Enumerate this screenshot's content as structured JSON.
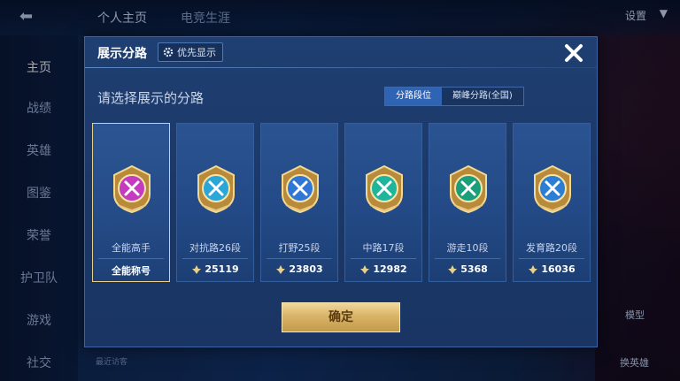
{
  "background": {
    "top_tabs": [
      "个人主页",
      "电竞生涯"
    ],
    "settings_label": "设置",
    "sidebar_items": [
      "主页",
      "战绩",
      "英雄",
      "图鉴",
      "荣誉",
      "护卫队",
      "游戏",
      "社交"
    ],
    "right_labels": [
      "模型",
      "换英雄"
    ]
  },
  "dialog": {
    "title": "展示分路",
    "priority_button": "优先显示",
    "subtitle": "请选择展示的分路",
    "segments": [
      "分路段位",
      "巅峰分路(全国)"
    ],
    "cards": [
      {
        "label": "全能高手",
        "value": "全能称号",
        "icon": "all-round-emblem-icon",
        "color": "#c43bbf",
        "selected": true,
        "has_power_icon": false
      },
      {
        "label": "对抗路26段",
        "value": "25119",
        "icon": "clash-lane-emblem-icon",
        "color": "#2aa6d8",
        "selected": false,
        "has_power_icon": true
      },
      {
        "label": "打野25段",
        "value": "23803",
        "icon": "jungle-emblem-icon",
        "color": "#2f76d6",
        "selected": false,
        "has_power_icon": true
      },
      {
        "label": "中路17段",
        "value": "12982",
        "icon": "mid-lane-emblem-icon",
        "color": "#1fb59a",
        "selected": false,
        "has_power_icon": true
      },
      {
        "label": "游走10段",
        "value": "5368",
        "icon": "roam-emblem-icon",
        "color": "#1b9e7a",
        "selected": false,
        "has_power_icon": true
      },
      {
        "label": "发育路20段",
        "value": "16036",
        "icon": "farm-lane-emblem-icon",
        "color": "#2b7ed4",
        "selected": false,
        "has_power_icon": true
      }
    ],
    "confirm_label": "确定"
  },
  "colors": {
    "accent_gold": "#e9cf8d",
    "segment_active": "#2f63b4"
  },
  "bottom_hint": "最近访客"
}
